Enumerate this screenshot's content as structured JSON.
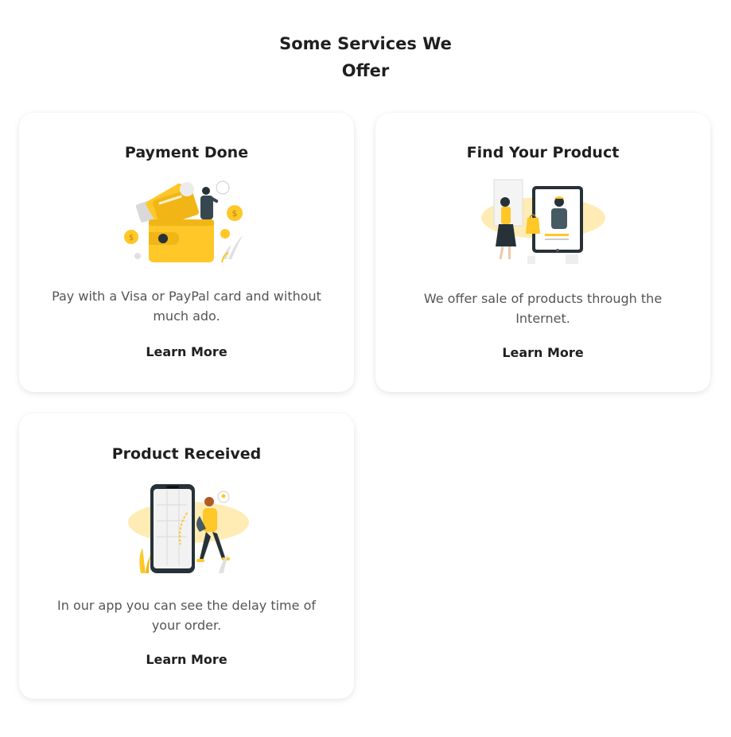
{
  "section": {
    "title_line1": "Some Services We",
    "title_line2": "Offer"
  },
  "services": [
    {
      "title": "Payment Done",
      "illustration_icon": "wallet-payment-icon",
      "description": "Pay with a Visa or PayPal card and without much ado.",
      "link_label": "Learn More"
    },
    {
      "title": "Find Your Product",
      "illustration_icon": "online-shopping-icon",
      "description": "We offer sale of products through the Internet.",
      "link_label": "Learn More"
    },
    {
      "title": "Product Received",
      "illustration_icon": "delivery-tracking-icon",
      "description": "In our app you can see the delay time of your order.",
      "link_label": "Learn More"
    }
  ],
  "colors": {
    "accent": "#FFC727",
    "text_dark": "#1F1F1F",
    "text_muted": "#555555",
    "figure_dark": "#263238"
  }
}
